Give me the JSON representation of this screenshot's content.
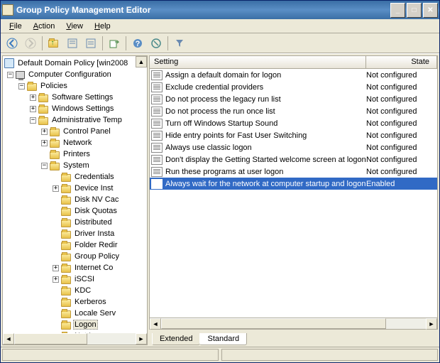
{
  "window": {
    "title": "Group Policy Management Editor"
  },
  "menu": {
    "file": "File",
    "action": "Action",
    "view": "View",
    "help": "Help"
  },
  "tree": {
    "root": "Default Domain Policy [win2008",
    "computer_config": "Computer Configuration",
    "policies": "Policies",
    "software_settings": "Software Settings",
    "windows_settings": "Windows Settings",
    "admin_templates": "Administrative Temp",
    "control_panel": "Control Panel",
    "network": "Network",
    "printers": "Printers",
    "system": "System",
    "credentials": "Credentials",
    "device_inst": "Device Inst",
    "disk_nv": "Disk NV Cac",
    "disk_quotas": "Disk Quotas",
    "distributed": "Distributed",
    "driver_inst": "Driver Insta",
    "folder_redir": "Folder Redir",
    "group_policy": "Group Policy",
    "internet_co": "Internet Co",
    "iscsi": "iSCSI",
    "kdc": "KDC",
    "kerberos": "Kerberos",
    "locale_serv": "Locale Serv",
    "logon": "Logon",
    "net_logon": "Net Logon"
  },
  "columns": {
    "setting": "Setting",
    "state": "State"
  },
  "settings": [
    {
      "name": "Assign a default domain for logon",
      "state": "Not configured"
    },
    {
      "name": "Exclude credential providers",
      "state": "Not configured"
    },
    {
      "name": "Do not process the legacy run list",
      "state": "Not configured"
    },
    {
      "name": "Do not process the run once list",
      "state": "Not configured"
    },
    {
      "name": "Turn off Windows Startup Sound",
      "state": "Not configured"
    },
    {
      "name": "Hide entry points for Fast User Switching",
      "state": "Not configured"
    },
    {
      "name": "Always use classic logon",
      "state": "Not configured"
    },
    {
      "name": "Don't display the Getting Started welcome screen at logon",
      "state": "Not configured"
    },
    {
      "name": "Run these programs at user logon",
      "state": "Not configured"
    },
    {
      "name": "Always wait for the network at computer startup and logon",
      "state": "Enabled"
    }
  ],
  "tabs": {
    "extended": "Extended",
    "standard": "Standard"
  }
}
